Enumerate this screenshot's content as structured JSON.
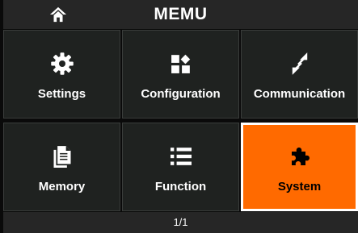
{
  "header": {
    "title": "MEMU",
    "home_icon": "home-icon"
  },
  "menu": {
    "tiles": [
      {
        "label": "Settings",
        "icon": "gear-icon"
      },
      {
        "label": "Configuration",
        "icon": "configuration-icon"
      },
      {
        "label": "Communication",
        "icon": "communication-arrows-icon"
      },
      {
        "label": "Memory",
        "icon": "documents-icon"
      },
      {
        "label": "Function",
        "icon": "list-icon"
      },
      {
        "label": "System",
        "icon": "puzzle-icon",
        "selected": true
      }
    ]
  },
  "footer": {
    "page": "1/1"
  },
  "colors": {
    "background": "#0a0a0a",
    "bar": "#262626",
    "tile": "#1f2220",
    "tile_border": "#3a3d3b",
    "selected": "#ff6a00",
    "text": "#ffffff"
  }
}
